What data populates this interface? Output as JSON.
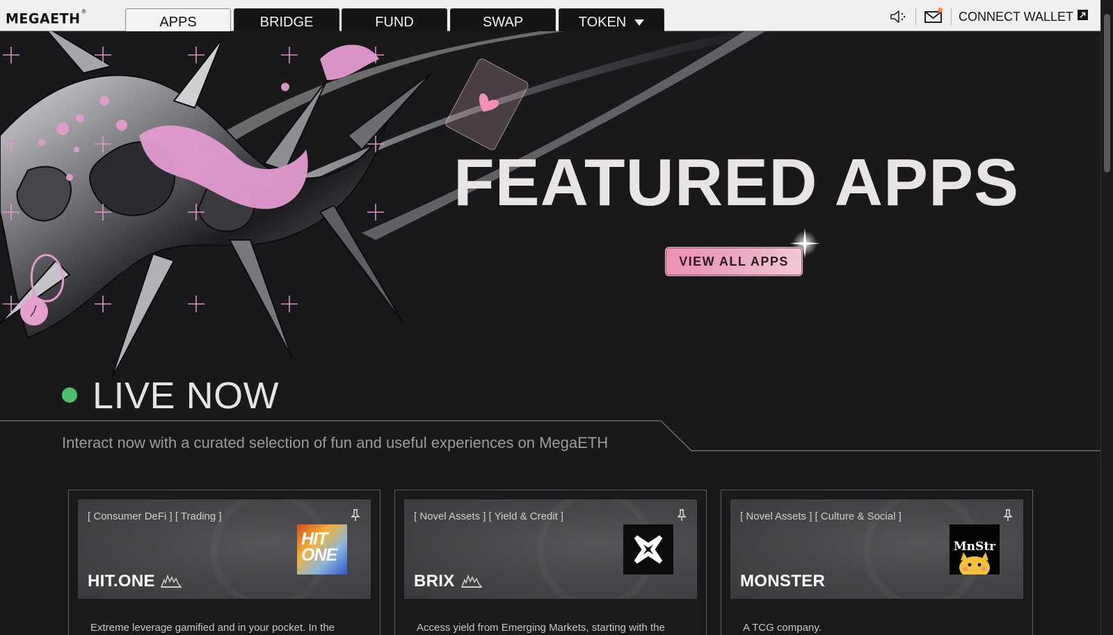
{
  "nav": {
    "logo": "MEGAETH",
    "logo_mark": "®",
    "tabs": [
      {
        "label": "APPS",
        "active": true
      },
      {
        "label": "BRIDGE",
        "active": false
      },
      {
        "label": "FUND",
        "active": false
      },
      {
        "label": "SWAP",
        "active": false
      },
      {
        "label": "TOKEN",
        "active": false,
        "has_dropdown": true
      }
    ],
    "icons": [
      "speaker-icon",
      "mail-icon",
      "external-link-icon"
    ],
    "connect_label": "CONNECT WALLET",
    "notification_color": "#ff8a3d"
  },
  "hero": {
    "title": "FEATURED APPS",
    "cta_label": "VIEW ALL APPS",
    "accent_color": "#ef9bbb"
  },
  "live": {
    "title": "LIVE NOW",
    "subtitle": "Interact now with a curated selection of fun and useful experiences on MegaETH",
    "status_color": "#4fbf6c"
  },
  "cards": [
    {
      "tags": "[ Consumer DeFi ] [ Trading ]",
      "name": "HIT.ONE",
      "has_flame": true,
      "logo_text_1": "HIT",
      "logo_text_2": "ONE",
      "description": "Extreme leverage gamified and in your pocket. In the"
    },
    {
      "tags": "[ Novel Assets ] [ Yield & Credit ]",
      "name": "BRIX",
      "has_flame": true,
      "description": "Access yield from Emerging Markets, starting with the"
    },
    {
      "tags": "[ Novel Assets ] [ Culture & Social ]",
      "name": "MONSTER",
      "has_flame": false,
      "logo_text": "MnStr",
      "description": "A TCG company."
    }
  ]
}
